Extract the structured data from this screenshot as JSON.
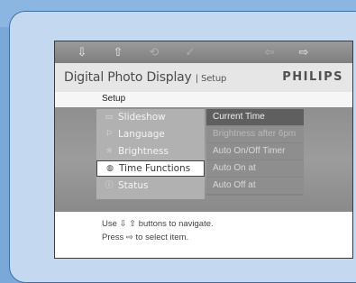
{
  "navbar": {
    "icons": [
      {
        "name": "arrow-down-icon",
        "glyph": "⇩",
        "enabled": true
      },
      {
        "name": "arrow-up-icon",
        "glyph": "⇧",
        "enabled": true
      },
      {
        "name": "back-icon",
        "glyph": "⟲",
        "enabled": false
      },
      {
        "name": "check-icon",
        "glyph": "✓",
        "enabled": false
      },
      {
        "name": "arrow-left-icon",
        "glyph": "⇦",
        "enabled": false
      },
      {
        "name": "arrow-right-icon",
        "glyph": "⇨",
        "enabled": true
      }
    ]
  },
  "header": {
    "title": "Digital Photo Display",
    "section": "| Setup",
    "brand": "PHILIPS"
  },
  "breadcrumb": "Setup",
  "menu": {
    "items": [
      {
        "label": "Slideshow",
        "icon": "▭"
      },
      {
        "label": "Language",
        "icon": "⚐"
      },
      {
        "label": "Brightness",
        "icon": "☼"
      },
      {
        "label": "Time Functions",
        "icon": "◍"
      },
      {
        "label": "Status",
        "icon": "ⓘ"
      }
    ],
    "selected": "Time Functions"
  },
  "submenu": {
    "items": [
      "Current Time",
      "Brightness after 6pm",
      "Auto On/Off Timer",
      "Auto On at",
      "Auto Off at"
    ]
  },
  "help": {
    "line1": "Use ⇩ ⇧ buttons to navigate.",
    "line2": "Press ⇨ to select item."
  },
  "colors": {
    "background": "#7aa8d8",
    "frame": "#c4d9ef",
    "menu_bg": "#9c9c9c",
    "selected_bg": "#ffffff"
  }
}
